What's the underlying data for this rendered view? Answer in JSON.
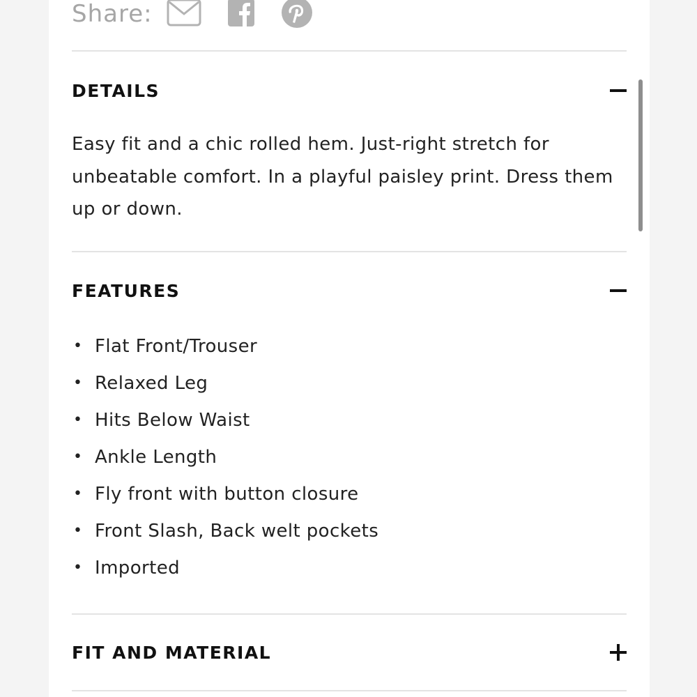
{
  "share": {
    "label": "Share:",
    "icons": [
      "mail-icon",
      "facebook-icon",
      "pinterest-icon"
    ]
  },
  "sections": [
    {
      "title": "DETAILS",
      "expanded": true,
      "toggle": "minus",
      "body": "Easy fit and a chic rolled hem. Just-right stretch for unbeatable comfort. In a playful paisley print. Dress them up or down."
    },
    {
      "title": "FEATURES",
      "expanded": true,
      "toggle": "minus",
      "items": [
        "Flat Front/Trouser",
        "Relaxed Leg",
        "Hits Below Waist",
        "Ankle Length",
        "Fly front with button closure",
        "Front Slash, Back welt pockets",
        "Imported"
      ]
    },
    {
      "title": "FIT AND MATERIAL",
      "expanded": false,
      "toggle": "plus"
    }
  ],
  "colors": {
    "text": "#111111",
    "muted": "#a6a6a6",
    "divider": "#e3e3e3",
    "background": "#ffffff"
  }
}
